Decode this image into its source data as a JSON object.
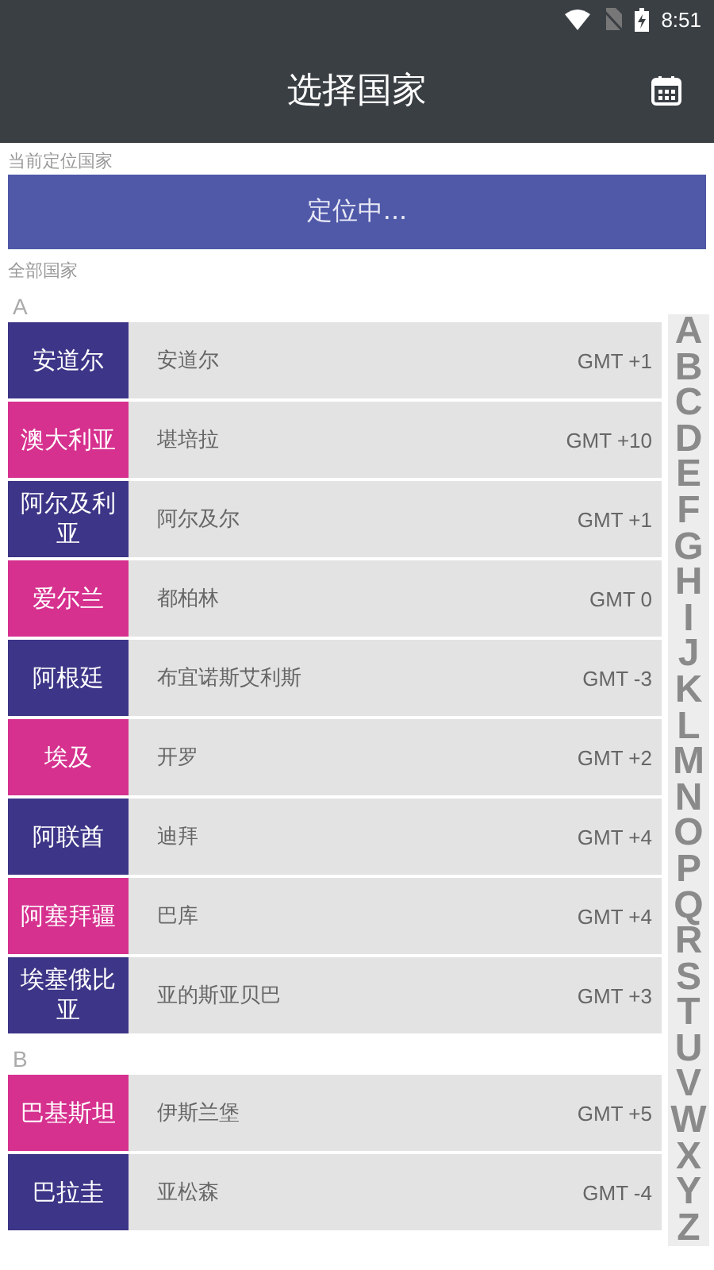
{
  "status_bar": {
    "time": "8:51"
  },
  "toolbar": {
    "title": "选择国家"
  },
  "current_section": {
    "label": "当前定位国家",
    "button": "定位中..."
  },
  "all_section": {
    "label": "全部国家"
  },
  "groups": [
    {
      "letter": "A",
      "countries": [
        {
          "name": "安道尔",
          "capital": "安道尔",
          "gmt": "GMT +1",
          "color": "#3d3587"
        },
        {
          "name": "澳大利亚",
          "capital": "堪培拉",
          "gmt": "GMT +10",
          "color": "#d6318f"
        },
        {
          "name": "阿尔及利亚",
          "capital": "阿尔及尔",
          "gmt": "GMT +1",
          "color": "#3d3587"
        },
        {
          "name": "爱尔兰",
          "capital": "都柏林",
          "gmt": "GMT 0",
          "color": "#d6318f"
        },
        {
          "name": "阿根廷",
          "capital": "布宜诺斯艾利斯",
          "gmt": "GMT -3",
          "color": "#3d3587"
        },
        {
          "name": "埃及",
          "capital": "开罗",
          "gmt": "GMT +2",
          "color": "#d6318f"
        },
        {
          "name": "阿联酋",
          "capital": "迪拜",
          "gmt": "GMT +4",
          "color": "#3d3587"
        },
        {
          "name": "阿塞拜疆",
          "capital": "巴库",
          "gmt": "GMT +4",
          "color": "#d6318f"
        },
        {
          "name": "埃塞俄比亚",
          "capital": "亚的斯亚贝巴",
          "gmt": "GMT +3",
          "color": "#3d3587"
        }
      ]
    },
    {
      "letter": "B",
      "countries": [
        {
          "name": "巴基斯坦",
          "capital": "伊斯兰堡",
          "gmt": "GMT +5",
          "color": "#d6318f"
        },
        {
          "name": "巴拉圭",
          "capital": "亚松森",
          "gmt": "GMT -4",
          "color": "#3d3587"
        }
      ]
    }
  ],
  "index_letters": [
    "A",
    "B",
    "C",
    "D",
    "E",
    "F",
    "G",
    "H",
    "I",
    "J",
    "K",
    "L",
    "M",
    "N",
    "O",
    "P",
    "Q",
    "R",
    "S",
    "T",
    "U",
    "V",
    "W",
    "X",
    "Y",
    "Z"
  ]
}
